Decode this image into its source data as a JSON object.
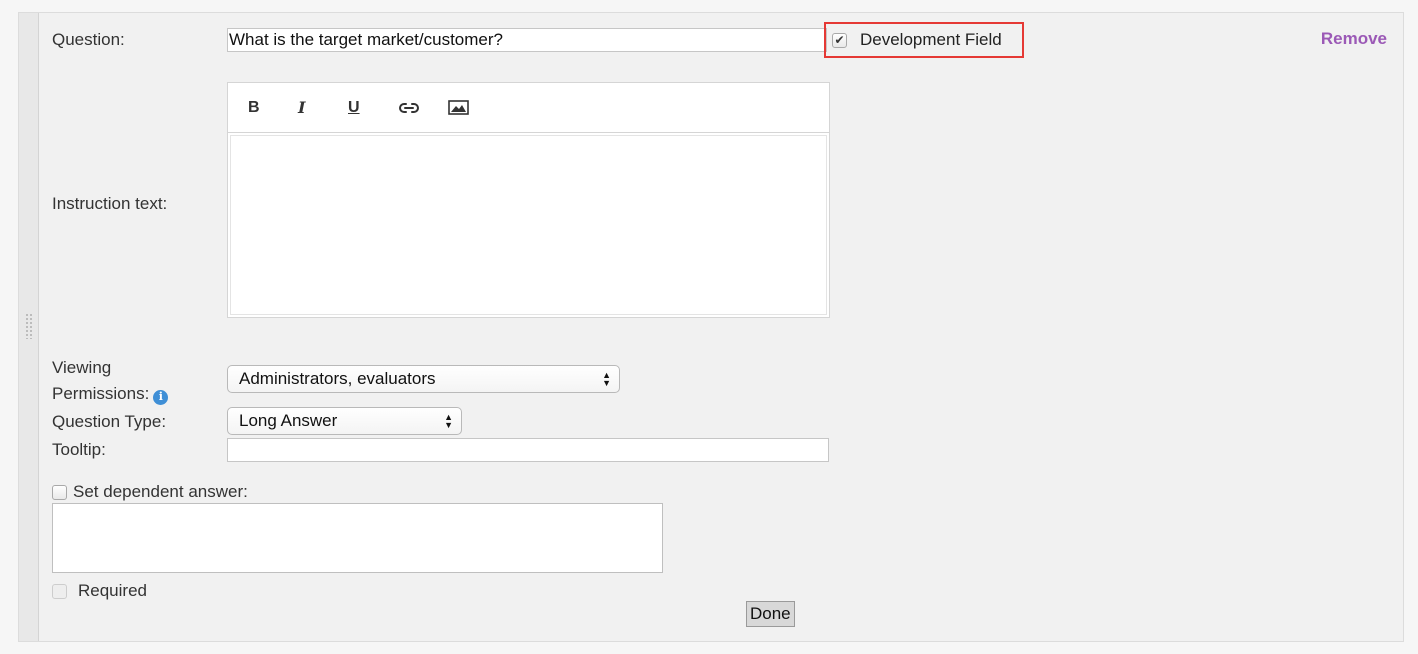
{
  "question": {
    "label": "Question:",
    "value": "What is the target market/customer?"
  },
  "development_field": {
    "label": "Development Field",
    "checked": true
  },
  "remove_label": "Remove",
  "instruction": {
    "label": "Instruction text:",
    "toolbar": [
      {
        "name": "bold",
        "icon": "B"
      },
      {
        "name": "italic",
        "icon": "I"
      },
      {
        "name": "underline",
        "icon": "U"
      },
      {
        "name": "link",
        "icon": "link-icon"
      },
      {
        "name": "image",
        "icon": "image-icon"
      }
    ],
    "value": ""
  },
  "viewing_permissions": {
    "label_line1": "Viewing",
    "label_line2": "Permissions:",
    "selected": "Administrators, evaluators"
  },
  "question_type": {
    "label": "Question Type:",
    "selected": "Long Answer"
  },
  "tooltip": {
    "label": "Tooltip:",
    "value": ""
  },
  "dependent_answer": {
    "label": "Set dependent answer:",
    "checked": false,
    "value": ""
  },
  "required": {
    "label": "Required",
    "checked": false,
    "disabled": true
  },
  "done_label": "Done",
  "colors": {
    "remove_link": "#9b59b6",
    "highlight_box": "#e53935",
    "info_icon": "#3f8fd6"
  }
}
